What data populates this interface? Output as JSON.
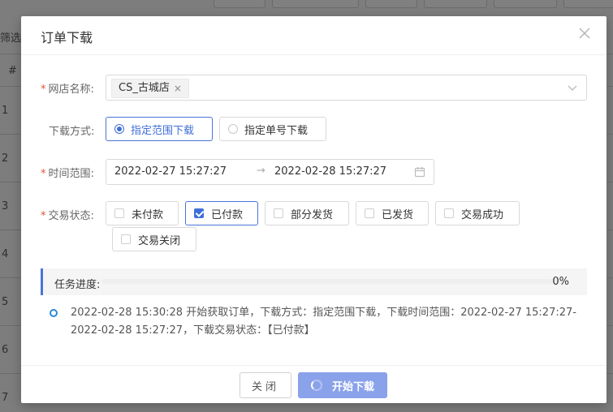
{
  "background": {
    "filter_label": "筛选",
    "hash_header": "#",
    "row_numbers": [
      "1",
      "2",
      "3",
      "4",
      "5",
      "6",
      "7"
    ]
  },
  "modal": {
    "title": "订单下载",
    "close_icon": "close-icon",
    "shop": {
      "label": "网店名称:",
      "required_mark": "*",
      "selected_tag": "CS_古城店",
      "tag_remove": "×",
      "dropdown_icon": "chevron-down-icon"
    },
    "download_mode": {
      "label": "下载方式:",
      "options": [
        {
          "label": "指定范围下载",
          "selected": true
        },
        {
          "label": "指定单号下载",
          "selected": false
        }
      ]
    },
    "time_range": {
      "label": "时间范围:",
      "required_mark": "*",
      "start": "2022-02-27 15:27:27",
      "separator": "→",
      "end": "2022-02-28 15:27:27",
      "calendar_icon": "calendar-icon"
    },
    "trade_status": {
      "label": "交易状态:",
      "required_mark": "*",
      "options": [
        {
          "label": "未付款",
          "checked": false
        },
        {
          "label": "已付款",
          "checked": true
        },
        {
          "label": "部分发货",
          "checked": false
        },
        {
          "label": "已发货",
          "checked": false
        },
        {
          "label": "交易成功",
          "checked": false
        },
        {
          "label": "交易关闭",
          "checked": false
        }
      ]
    },
    "progress": {
      "label": "任务进度:",
      "percent_text": "0%",
      "value": 0
    },
    "log": {
      "entries": [
        "2022-02-28 15:30:28 开始获取订单，下载方式：指定范围下载，下载时间范围：2022-02-27 15:27:27-2022-02-28 15:27:27，下载交易状态：【已付款】"
      ]
    },
    "footer": {
      "close_label": "关闭",
      "start_label": "开始下载"
    }
  },
  "colors": {
    "accent": "#3f6fd8",
    "required": "#e0533c",
    "primary_button_loading": "#8aa2ea"
  }
}
